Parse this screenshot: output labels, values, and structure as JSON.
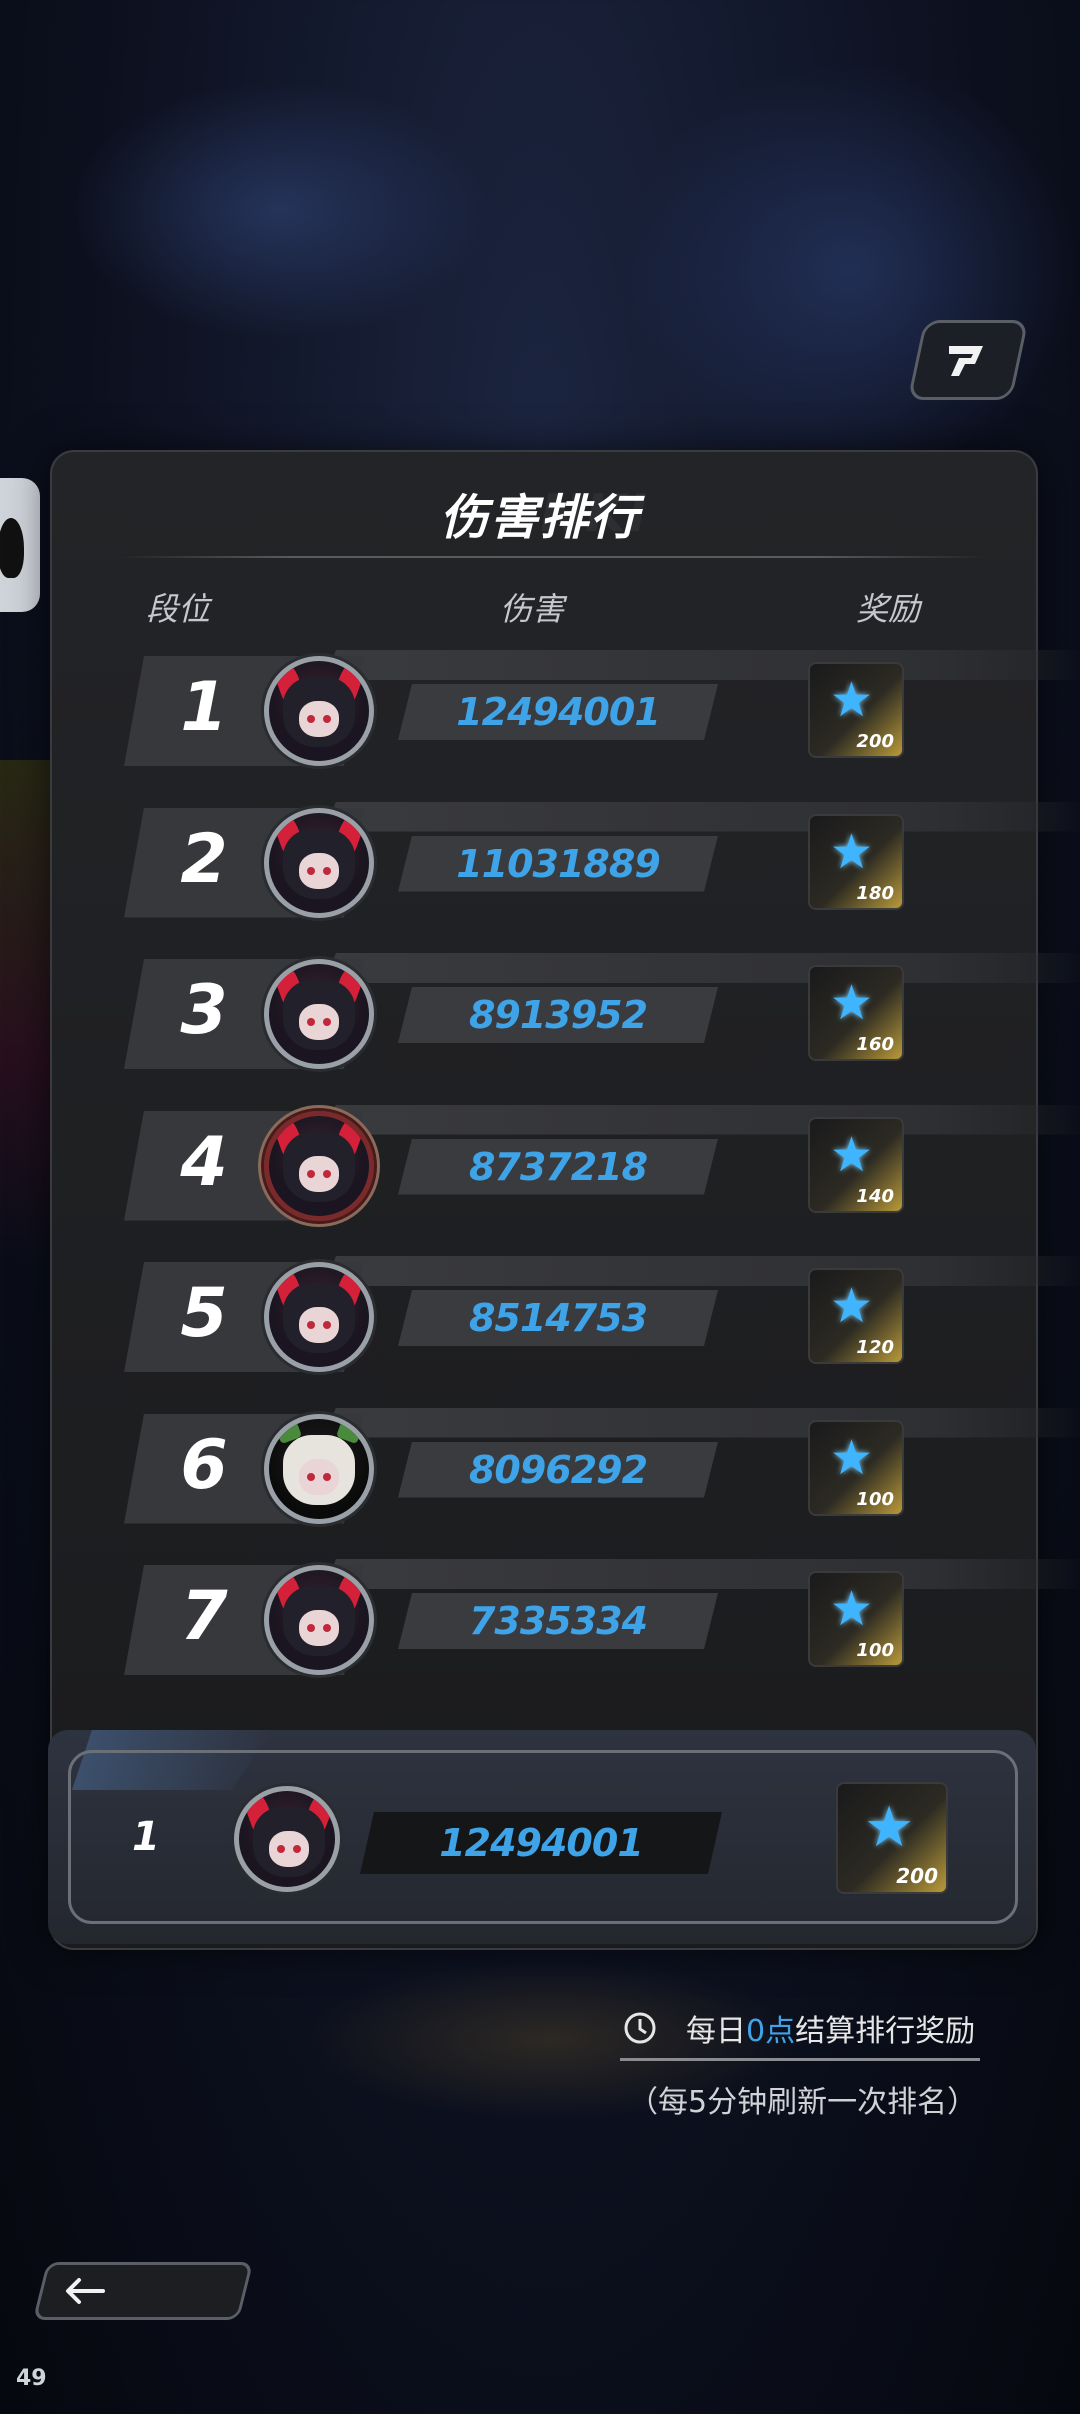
{
  "title": "伤害排行",
  "title_bg": "NKI",
  "columns": {
    "rank": "段位",
    "damage": "伤害",
    "reward": "奖励"
  },
  "rows": [
    {
      "rank": "1",
      "damage": "12494001",
      "reward": "200",
      "avatar": "demon-girl"
    },
    {
      "rank": "2",
      "damage": "11031889",
      "reward": "180",
      "avatar": "demon-girl"
    },
    {
      "rank": "3",
      "damage": "8913952",
      "reward": "160",
      "avatar": "demon-girl"
    },
    {
      "rank": "4",
      "damage": "8737218",
      "reward": "140",
      "avatar": "demon-girl-dark"
    },
    {
      "rank": "5",
      "damage": "8514753",
      "reward": "120",
      "avatar": "demon-girl"
    },
    {
      "rank": "6",
      "damage": "8096292",
      "reward": "100",
      "avatar": "white-hair-girl"
    },
    {
      "rank": "7",
      "damage": "7335334",
      "reward": "100",
      "avatar": "demon-girl"
    }
  ],
  "my_rank": {
    "rank": "1",
    "damage": "12494001",
    "reward": "200"
  },
  "info": {
    "prefix": "每日",
    "highlight": "0点",
    "suffix": "结算排行奖励",
    "refresh": "（每5分钟刷新一次排名）"
  },
  "fps": "49",
  "colors": {
    "accent": "#3fa3e8",
    "panel": "#1f2023"
  },
  "icons": {
    "share": "share-icon",
    "back": "arrow-left-icon",
    "clock": "clock-icon",
    "reward": "blue-star-icon"
  }
}
